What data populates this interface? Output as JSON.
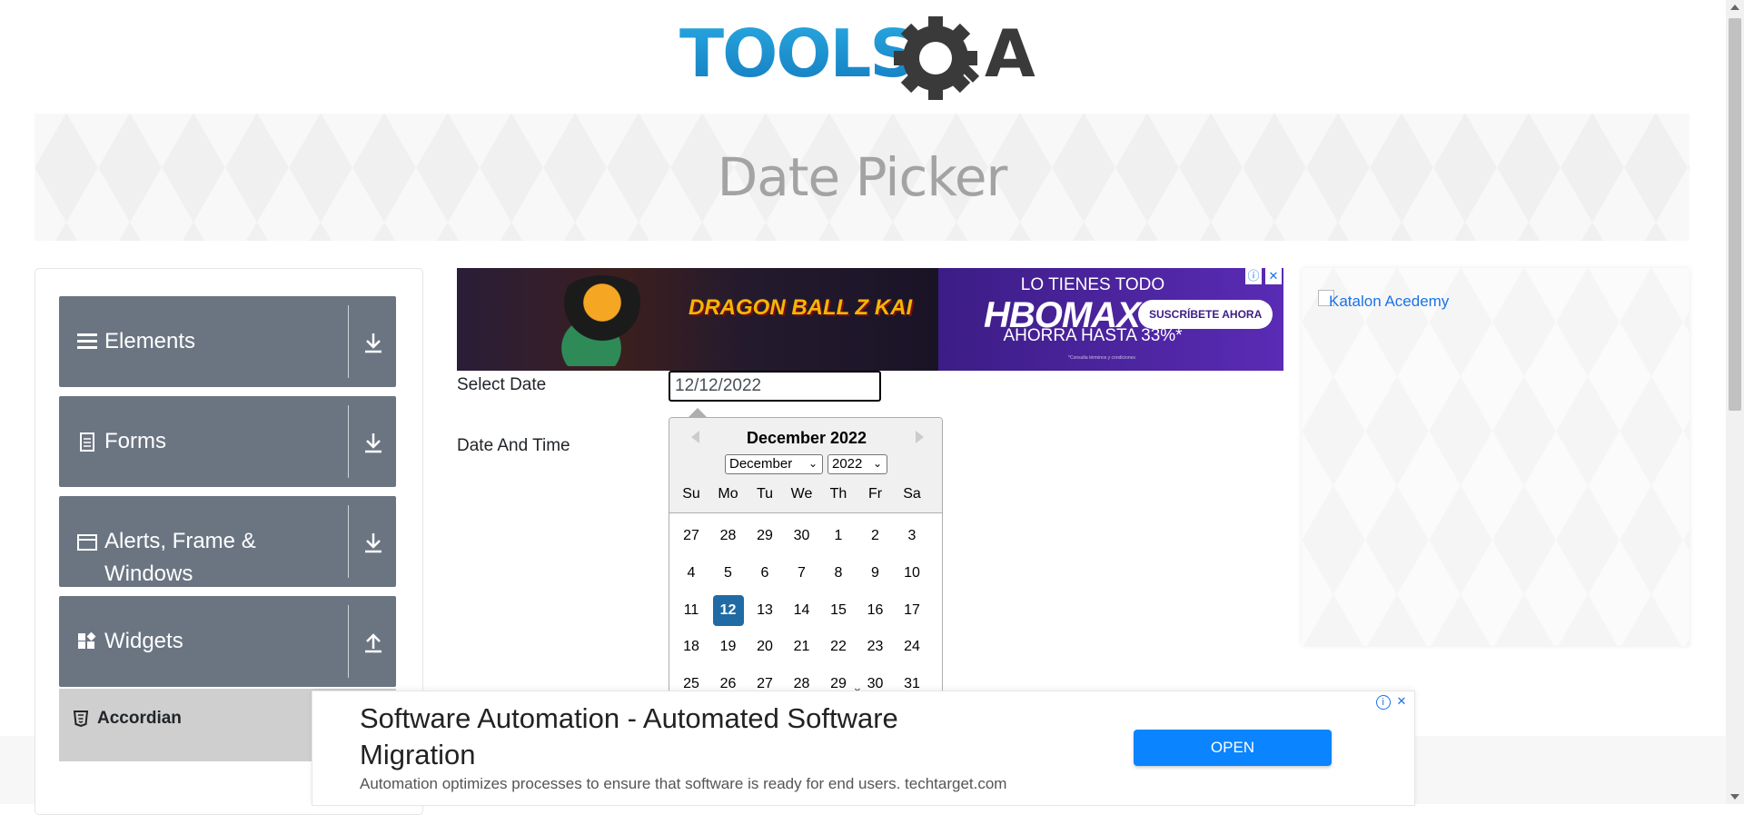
{
  "site": {
    "logo_text": "TOOLSQA"
  },
  "page": {
    "title": "Date Picker"
  },
  "sidebar": {
    "groups": [
      {
        "label": "Elements",
        "icon": "hamburger-icon",
        "state": "collapsed"
      },
      {
        "label": "Forms",
        "icon": "document-icon",
        "state": "collapsed"
      },
      {
        "label": "Alerts, Frame &",
        "label_line2": "Windows",
        "icon": "window-icon",
        "state": "collapsed"
      },
      {
        "label": "Widgets",
        "icon": "widgets-icon",
        "state": "expanded"
      }
    ],
    "active_item": {
      "label": "Accordian",
      "icon": "html5-icon"
    }
  },
  "top_ad": {
    "left_title": "DRAGON BALL Z KAI",
    "headline": "LO TIENES TODO",
    "brand": "HBOMAX",
    "cta": "SUSCRÍBETE AHORA",
    "offer": "AHORRA HASTA 33%*",
    "fine_print": "*Consulta términos y condiciones"
  },
  "form": {
    "select_date_label": "Select Date",
    "select_date_value": "12/12/2022",
    "date_time_label": "Date And Time"
  },
  "calendar": {
    "month_title": "December 2022",
    "month_select": "December",
    "year_select": "2022",
    "weekdays": [
      "Su",
      "Mo",
      "Tu",
      "We",
      "Th",
      "Fr",
      "Sa"
    ],
    "weeks": [
      [
        "27",
        "28",
        "29",
        "30",
        "1",
        "2",
        "3"
      ],
      [
        "4",
        "5",
        "6",
        "7",
        "8",
        "9",
        "10"
      ],
      [
        "11",
        "12",
        "13",
        "14",
        "15",
        "16",
        "17"
      ],
      [
        "18",
        "19",
        "20",
        "21",
        "22",
        "23",
        "24"
      ],
      [
        "25",
        "26",
        "27",
        "28",
        "29",
        "30",
        "31"
      ]
    ],
    "selected_day": "12"
  },
  "right_ad": {
    "alt_text": "Katalon Acedemy"
  },
  "bottom_ad": {
    "title": "Software Automation - Automated Software Migration",
    "description": "Automation optimizes processes to ensure that software is ready for end users. techtarget.com",
    "button": "OPEN"
  },
  "colors": {
    "sidebar_group_bg": "#6b7582",
    "selected_day_bg": "#216ba5",
    "logo_blue": "#1b9ad6",
    "logo_dark": "#3a3a3a",
    "open_button": "#0a84ff"
  }
}
